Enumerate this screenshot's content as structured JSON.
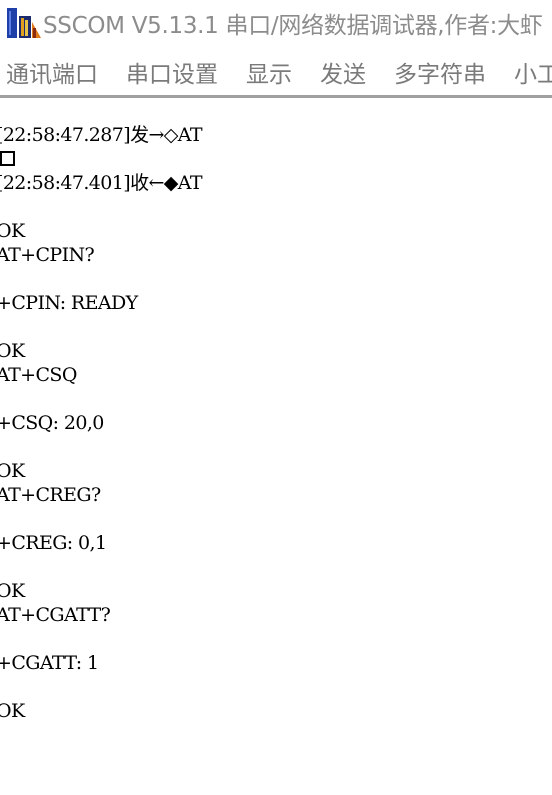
{
  "window": {
    "title": "SSCOM V5.13.1 串口/网络数据调试器,作者:大虾"
  },
  "menu": {
    "items": [
      "通讯端口",
      "串口设置",
      "显示",
      "发送",
      "多字符串",
      "小工具"
    ]
  },
  "log": {
    "line1": "[22:58:47.287]发→◇AT",
    "line3": "[22:58:47.401]收←◆AT",
    "line4": "OK",
    "line5": "AT+CPIN?",
    "line6": "+CPIN: READY",
    "line7": "OK",
    "line8": "AT+CSQ",
    "line9": "+CSQ: 20,0",
    "line10": "OK",
    "line11": "AT+CREG?",
    "line12": "+CREG: 0,1",
    "line13": "OK",
    "line14": "AT+CGATT?",
    "line15": "+CGATT: 1",
    "line16": "OK"
  },
  "colors": {
    "title_text": "#8c8c8c",
    "menu_text": "#7a7a7a",
    "separator": "#a0a0a0",
    "log_text": "#000000"
  },
  "icons": {
    "app": "sscom-app-icon",
    "box": "unprintable-char-box"
  }
}
